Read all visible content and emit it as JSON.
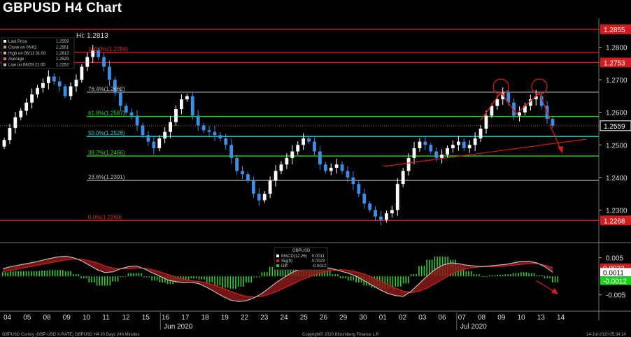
{
  "page_title": "GBPUSD H4 Chart",
  "colors": {
    "background": "#000000",
    "bull": "#ffffff",
    "bear": "#3a8ee6",
    "red_line": "#d01c1c",
    "green_line": "#19d119",
    "cyan_line": "#2bd4d4",
    "grey_line": "#a0a0a0",
    "macd_fill": "#8a1a1a",
    "diff_bar": "#2ecc2e"
  },
  "chart_data": {
    "type": "candlestick",
    "title": "GBPUSD H4 Chart",
    "xlabel": "",
    "ylabel": "",
    "ylim": [
      1.2215,
      1.2885
    ],
    "y_ticks": [
      "1.2800",
      "1.2700",
      "1.2600",
      "1.2500",
      "1.2400",
      "1.2300"
    ],
    "y_tick_values": [
      1.28,
      1.27,
      1.26,
      1.25,
      1.24,
      1.23
    ],
    "x_ticks": [
      "04",
      "05",
      "08",
      "09",
      "10",
      "11",
      "12",
      "15",
      "16",
      "17",
      "18",
      "19",
      "22",
      "23",
      "24",
      "25",
      "26",
      "29",
      "30",
      "01",
      "02",
      "03",
      "06",
      "07",
      "08",
      "09",
      "10",
      "13",
      "14"
    ],
    "month_labels": [
      {
        "label": "Jun 2020",
        "after_tick": "15"
      },
      {
        "label": "Jul 2020",
        "after_tick": "06"
      }
    ],
    "hi_label": "Hi: 1.2813",
    "price_labels": [
      {
        "value": 1.2855,
        "label": "1.2855",
        "color": "#d01c1c"
      },
      {
        "value": 1.2753,
        "label": "1.2753",
        "color": "#d01c1c"
      },
      {
        "value": 1.2559,
        "label": "1.2559",
        "color": "#ffffff"
      },
      {
        "value": 1.2268,
        "label": "1.2268",
        "color": "#d01c1c"
      }
    ],
    "horizontal_levels": [
      {
        "value": 1.2855,
        "color": "red"
      },
      {
        "value": 1.2784,
        "color": "red"
      },
      {
        "value": 1.2753,
        "color": "red"
      },
      {
        "value": 1.2662,
        "color": "grey"
      },
      {
        "value": 1.25874,
        "color": "green"
      },
      {
        "value": 1.2526,
        "color": "cyan"
      },
      {
        "value": 1.2466,
        "color": "green"
      },
      {
        "value": 1.2391,
        "color": "grey"
      },
      {
        "value": 1.2268,
        "color": "red"
      }
    ],
    "fib_labels": [
      {
        "text": "100.0%(1.2784)",
        "value": 1.2784,
        "color": "#e03030"
      },
      {
        "text": "76.4%(1.2662)",
        "value": 1.2662,
        "color": "#bdbdbd"
      },
      {
        "text": "61.8%(1.2587)",
        "value": 1.25874,
        "color": "#2fd52f"
      },
      {
        "text": "50.0%(1.2526)",
        "value": 1.2526,
        "color": "#36d0d0"
      },
      {
        "text": "38.2%(1.2466)",
        "value": 1.2466,
        "color": "#2fd52f"
      },
      {
        "text": "23.6%(1.2391)",
        "value": 1.2391,
        "color": "#bdbdbd"
      },
      {
        "text": "0.0%(1.2269)",
        "value": 1.2268,
        "color": "#e03030"
      }
    ],
    "legend": [
      {
        "text": "Last Price",
        "value": "1.2559"
      },
      {
        "text": "Close on 06/02",
        "value": "1.2551"
      },
      {
        "text": "High on 06/11 01:00",
        "value": "1.2813"
      },
      {
        "text": "Average",
        "value": "1.2529"
      },
      {
        "text": "Low on 06/29 21:00",
        "value": "1.2252"
      }
    ],
    "close_path": [
      1.2515,
      1.2552,
      1.2585,
      1.2605,
      1.263,
      1.2655,
      1.2675,
      1.269,
      1.271,
      1.2695,
      1.268,
      1.265,
      1.268,
      1.27,
      1.274,
      1.277,
      1.279,
      1.277,
      1.274,
      1.27,
      1.266,
      1.262,
      1.26,
      1.259,
      1.256,
      1.253,
      1.251,
      1.249,
      1.252,
      1.254,
      1.257,
      1.261,
      1.264,
      1.265,
      1.259,
      1.256,
      1.2545,
      1.254,
      1.253,
      1.252,
      1.25,
      1.246,
      1.242,
      1.241,
      1.239,
      1.235,
      1.233,
      1.235,
      1.239,
      1.242,
      1.244,
      1.246,
      1.248,
      1.25,
      1.252,
      1.251,
      1.248,
      1.244,
      1.242,
      1.243,
      1.244,
      1.242,
      1.24,
      1.238,
      1.235,
      1.232,
      1.23,
      1.228,
      1.227,
      1.229,
      1.23,
      1.238,
      1.242,
      1.246,
      1.249,
      1.251,
      1.25,
      1.248,
      1.246,
      1.247,
      1.249,
      1.25,
      1.251,
      1.249,
      1.25,
      1.252,
      1.255,
      1.259,
      1.262,
      1.264,
      1.266,
      1.263,
      1.259,
      1.26,
      1.262,
      1.264,
      1.265,
      1.262,
      1.258,
      1.2559
    ],
    "macd": {
      "y_ticks": [
        "0.005",
        "-0.005"
      ],
      "y_tick_values": [
        0.005,
        -0.005
      ],
      "ylim": [
        -0.009,
        0.0085
      ],
      "labels": [
        {
          "text": "0.0023",
          "value": 0.0023,
          "bg": "#d01c1c"
        },
        {
          "text": "0.0011",
          "value": 0.0011,
          "bg": "#ffffff"
        },
        {
          "text": "-0.0012",
          "value": -0.0012,
          "bg": "#19d119"
        }
      ],
      "legend_title": "GBPUSD",
      "legend": [
        {
          "text": "MACD(12,26)",
          "value": "0.0011",
          "color": "#ffffff"
        },
        {
          "text": "Sig(9)",
          "value": "0.0023",
          "color": "#d01c1c"
        },
        {
          "text": "Diff",
          "value": "-0.0012",
          "color": "#19d119"
        }
      ],
      "macd_series": [
        0.002,
        0.0026,
        0.003,
        0.0034,
        0.0038,
        0.0043,
        0.0048,
        0.0052,
        0.0054,
        0.005,
        0.0042,
        0.003,
        0.0018,
        0.001,
        0.0012,
        0.002,
        0.0026,
        0.0028,
        0.002,
        0.001,
        0.0,
        -0.001,
        -0.0014,
        -0.0018,
        -0.0016,
        -0.002,
        -0.003,
        -0.0042,
        -0.0054,
        -0.0064,
        -0.0068,
        -0.0066,
        -0.0058,
        -0.0046,
        -0.003,
        -0.0014,
        0.0,
        0.0012,
        0.002,
        0.0024,
        0.0026,
        0.0024,
        0.002,
        0.0014,
        0.0008,
        0.0,
        -0.0012,
        -0.0024,
        -0.0036,
        -0.0046,
        -0.0052,
        -0.0054,
        -0.004,
        -0.002,
        0.0,
        0.0018,
        0.003,
        0.0036,
        0.0034,
        0.003,
        0.0028,
        0.0026,
        0.0028,
        0.003,
        0.0032,
        0.0036,
        0.004,
        0.004,
        0.0036,
        0.0026,
        0.0011
      ],
      "signal_series": [
        0.0012,
        0.0016,
        0.002,
        0.0024,
        0.0028,
        0.0032,
        0.0036,
        0.004,
        0.0044,
        0.0046,
        0.0046,
        0.0042,
        0.0036,
        0.0028,
        0.0022,
        0.002,
        0.002,
        0.0022,
        0.0022,
        0.0018,
        0.0012,
        0.0005,
        -0.0002,
        -0.0008,
        -0.0012,
        -0.0014,
        -0.0018,
        -0.0024,
        -0.0032,
        -0.004,
        -0.0048,
        -0.0054,
        -0.0056,
        -0.0054,
        -0.0048,
        -0.004,
        -0.003,
        -0.002,
        -0.001,
        -0.0002,
        0.0006,
        0.0012,
        0.0016,
        0.0018,
        0.0016,
        0.0012,
        0.0006,
        -0.0002,
        -0.0012,
        -0.0022,
        -0.0032,
        -0.004,
        -0.0044,
        -0.004,
        -0.0032,
        -0.002,
        -0.0008,
        0.0004,
        0.0014,
        0.002,
        0.0024,
        0.0026,
        0.0026,
        0.0027,
        0.0028,
        0.003,
        0.0032,
        0.0034,
        0.0034,
        0.003,
        0.0023
      ]
    }
  },
  "footer": {
    "left": "GBPUSD Curncy (GBP-USD X-RATE) GBPUSD H4 30 Days 240 Minutes",
    "center": "Copyright© 2020 Bloomberg Finance L.P.",
    "right": "14-Jul-2020 05:34:14"
  }
}
